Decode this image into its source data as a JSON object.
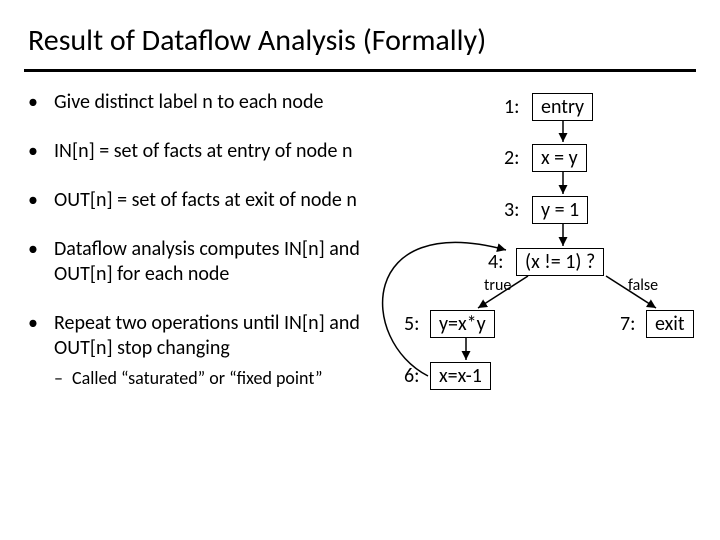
{
  "title": "Result of Dataflow Analysis (Formally)",
  "bullets": {
    "b1": "Give distinct label n to each node",
    "b2": "IN[n] = set of facts at entry of node n",
    "b3": "OUT[n] = set of facts at exit of node n",
    "b4": "Dataflow analysis computes IN[n] and OUT[n] for each node",
    "b5": "Repeat two operations until IN[n] and OUT[n] stop changing",
    "b5_sub": "Called “saturated” or “fixed point”"
  },
  "diagram": {
    "n1_lbl": "1:",
    "n1": "entry",
    "n2_lbl": "2:",
    "n2": "x = y",
    "n3_lbl": "3:",
    "n3": "y = 1",
    "n4_lbl": "4:",
    "n4": "(x != 1) ?",
    "n5_lbl": "5:",
    "n5": "y=x*y",
    "n6_lbl": "6:",
    "n6": "x=x-1",
    "n7_lbl": "7:",
    "n7": "exit",
    "true_lbl": "true",
    "false_lbl": "false"
  }
}
